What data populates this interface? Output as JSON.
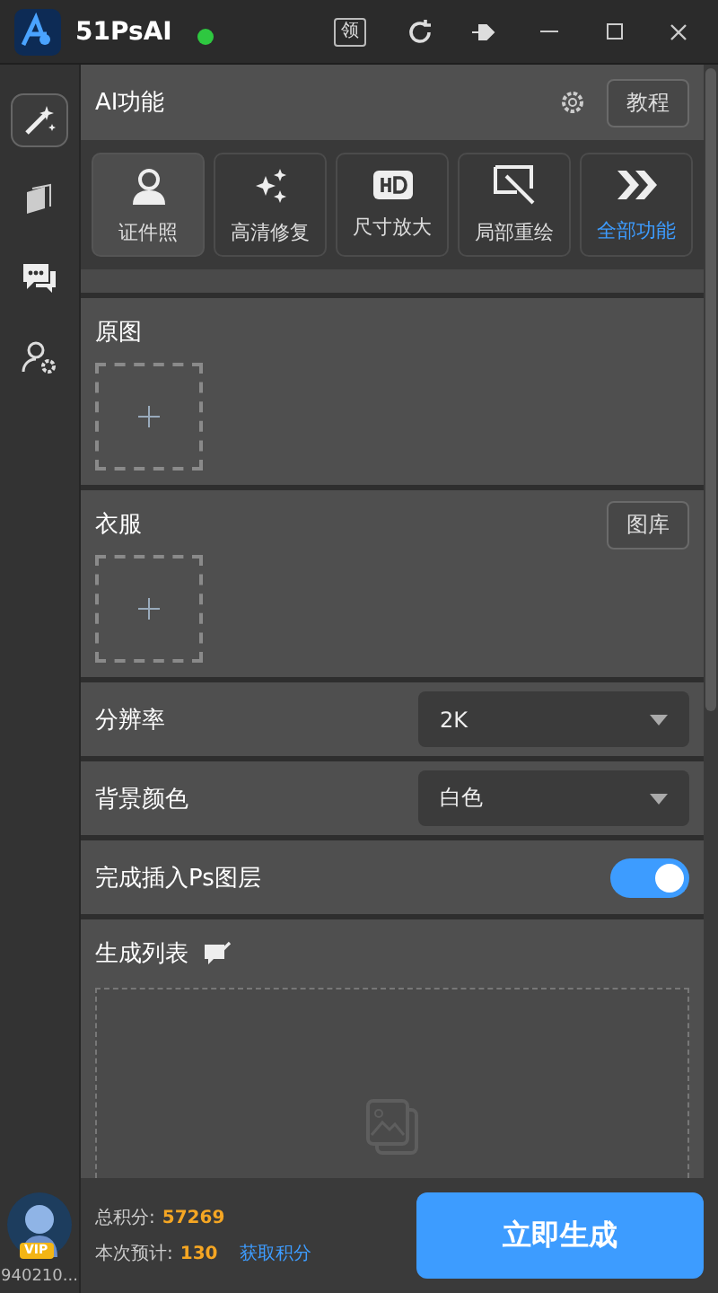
{
  "window": {
    "title": "51PsAI",
    "online": true,
    "toolbar": [
      {
        "kind": "claim",
        "label": "领"
      },
      {
        "kind": "refresh"
      },
      {
        "kind": "pin"
      },
      {
        "kind": "minimize"
      },
      {
        "kind": "maximize"
      },
      {
        "kind": "close"
      }
    ]
  },
  "sidebar": {
    "items": [
      {
        "kind": "magic",
        "selected": true
      },
      {
        "kind": "layers",
        "selected": false
      },
      {
        "kind": "chat",
        "selected": false
      },
      {
        "kind": "user-settings",
        "selected": false
      }
    ],
    "user": {
      "badge": "VIP",
      "id": "940210..."
    }
  },
  "ai_panel": {
    "title": "AI功能",
    "tutorial_button": "教程",
    "features": [
      {
        "kind": "portrait",
        "label": "证件照",
        "selected": true
      },
      {
        "kind": "sparkle",
        "label": "高清修复",
        "selected": false
      },
      {
        "kind": "hd",
        "label": "尺寸放大",
        "selected": false
      },
      {
        "kind": "repaint",
        "label": "局部重绘",
        "selected": false
      },
      {
        "kind": "more",
        "label": "全部功能",
        "selected": false
      }
    ]
  },
  "uploads": [
    {
      "label": "原图"
    },
    {
      "label": "衣服",
      "button": "图库"
    }
  ],
  "settings": [
    {
      "kind": "select",
      "label": "分辨率",
      "value": "2K"
    },
    {
      "kind": "select",
      "label": "背景颜色",
      "value": "白色"
    },
    {
      "kind": "toggle",
      "label": "完成插入Ps图层",
      "on": true
    }
  ],
  "results": {
    "title": "生成列表"
  },
  "footer": {
    "total_label": "总积分:",
    "total": "57269",
    "cost_label": "本次预计:",
    "cost": "130",
    "earn_link": "获取积分",
    "generate_button": "立即生成"
  }
}
